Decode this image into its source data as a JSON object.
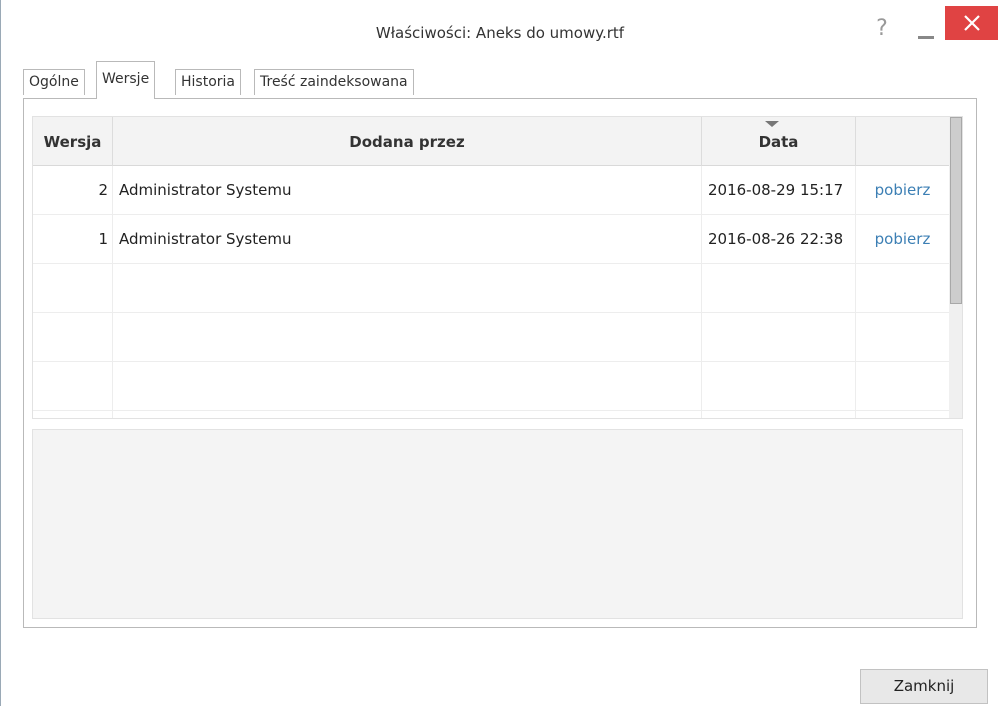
{
  "window": {
    "title": "Właściwości: Aneks do umowy.rtf",
    "help": "?"
  },
  "tabs": [
    {
      "label": "Ogólne",
      "active": false
    },
    {
      "label": "Wersje",
      "active": true
    },
    {
      "label": "Historia",
      "active": false
    },
    {
      "label": "Treść zaindeksowana",
      "active": false
    }
  ],
  "table": {
    "headers": {
      "version": "Wersja",
      "added_by": "Dodana przez",
      "date": "Data",
      "action": ""
    },
    "rows": [
      {
        "version": "2",
        "added_by": "Administrator Systemu",
        "date": "2016-08-29 15:17",
        "action": "pobierz"
      },
      {
        "version": "1",
        "added_by": "Administrator Systemu",
        "date": "2016-08-26 22:38",
        "action": "pobierz"
      }
    ]
  },
  "footer": {
    "close_label": "Zamknij"
  },
  "colors": {
    "close_button_bg": "#e04343",
    "link": "#3c7fb4"
  }
}
